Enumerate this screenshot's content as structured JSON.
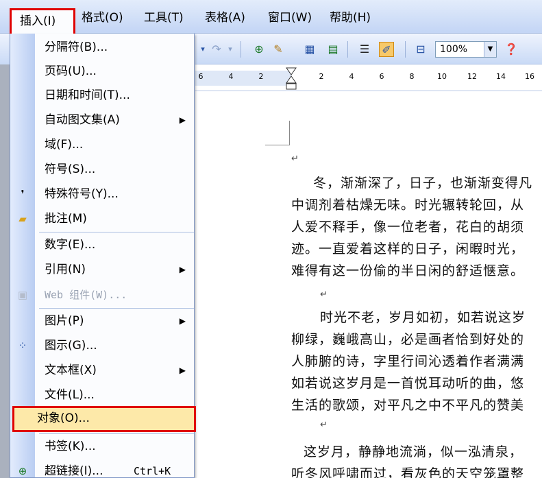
{
  "menubar": {
    "items": [
      {
        "label": "插入(I)"
      },
      {
        "label": "格式(O)"
      },
      {
        "label": "工具(T)"
      },
      {
        "label": "表格(A)"
      },
      {
        "label": "窗口(W)"
      },
      {
        "label": "帮助(H)"
      }
    ]
  },
  "toolbar": {
    "zoom": "100%"
  },
  "ruler": {
    "ticks": [
      "6",
      "4",
      "2",
      "2",
      "4",
      "6",
      "8",
      "10",
      "12",
      "14",
      "16"
    ]
  },
  "menu": {
    "items": [
      {
        "label": "分隔符(B)..."
      },
      {
        "label": "页码(U)..."
      },
      {
        "label": "日期和时间(T)..."
      },
      {
        "label": "自动图文集(A)"
      },
      {
        "label": "域(F)..."
      },
      {
        "label": "符号(S)..."
      },
      {
        "label": "特殊符号(Y)..."
      },
      {
        "label": "批注(M)"
      },
      {
        "label": "数字(E)..."
      },
      {
        "label": "引用(N)"
      },
      {
        "label": "Web 组件(W)..."
      },
      {
        "label": "图片(P)"
      },
      {
        "label": "图示(G)..."
      },
      {
        "label": "文本框(X)"
      },
      {
        "label": "文件(L)..."
      },
      {
        "label": "对象(O)..."
      },
      {
        "label": "书签(K)..."
      },
      {
        "label": "超链接(I)...",
        "shortcut": "Ctrl+K"
      }
    ]
  },
  "document": {
    "lines": [
      "冬，渐渐深了，日子，也渐渐变得凡",
      "中调剂着枯燥无味。时光辗转轮回，从",
      "人爱不释手，像一位老者，花白的胡须",
      "迹。一直爱着这样的日子，闲暇时光，",
      "难得有这一份偷的半日闲的舒适惬意。",
      "时光不老，岁月如初，如若说这岁",
      "柳绿，巍峨高山，必是画者恰到好处的",
      "人肺腑的诗，字里行间沁透着作者满满",
      "如若说这岁月是一首悦耳动听的曲，悠",
      "生活的歌颂，对平凡之中不平凡的赞美",
      "这岁月，静静地流淌，似一泓清泉，",
      "听冬风呼啸而过，看灰色的天空笼罩整"
    ]
  }
}
